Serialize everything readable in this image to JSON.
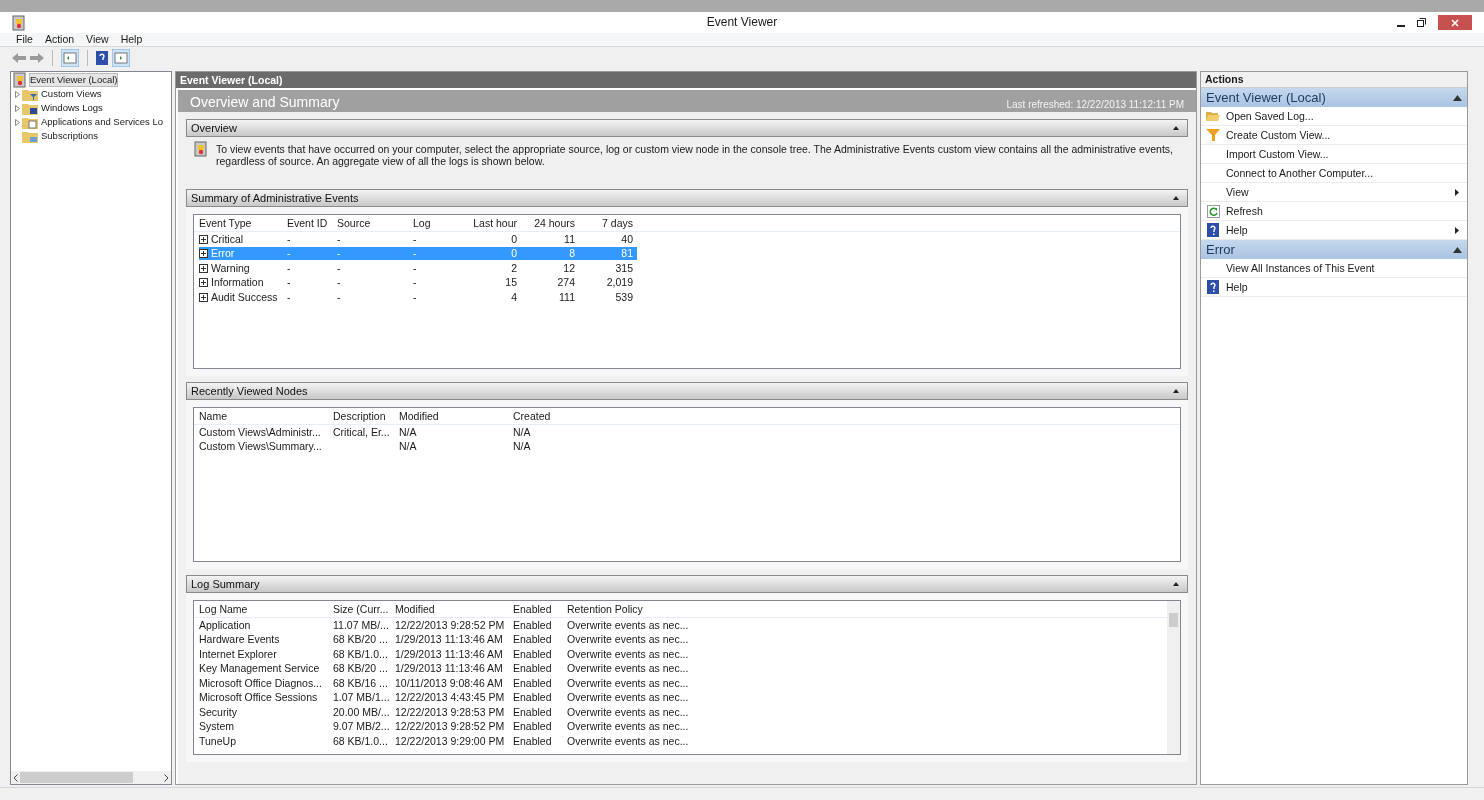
{
  "window": {
    "title": "Event Viewer"
  },
  "menu": [
    "File",
    "Action",
    "View",
    "Help"
  ],
  "tree": [
    {
      "label": "Event Viewer (Local)",
      "selected": true,
      "expandable": false
    },
    {
      "label": "Custom Views",
      "selected": false,
      "expandable": true
    },
    {
      "label": "Windows Logs",
      "selected": false,
      "expandable": true
    },
    {
      "label": "Applications and Services Lo",
      "selected": false,
      "expandable": true
    },
    {
      "label": "Subscriptions",
      "selected": false,
      "expandable": false
    }
  ],
  "center": {
    "header": "Event Viewer (Local)",
    "title": "Overview and Summary",
    "last_refreshed": "Last refreshed: 12/22/2013 11:12:11 PM",
    "overview": {
      "title": "Overview",
      "text": "To view events that have occurred on your computer, select the appropriate source, log or custom view node in the console tree. The Administrative Events custom view contains all the administrative events, regardless of source. An aggregate view of all the logs is shown below."
    },
    "summary": {
      "title": "Summary of Administrative Events",
      "columns": [
        "Event Type",
        "Event ID",
        "Source",
        "Log",
        "Last hour",
        "24 hours",
        "7 days"
      ],
      "rows": [
        {
          "cells": [
            "Critical",
            "-",
            "-",
            "-",
            "0",
            "11",
            "40"
          ],
          "selected": false
        },
        {
          "cells": [
            "Error",
            "-",
            "-",
            "-",
            "0",
            "8",
            "81"
          ],
          "selected": true
        },
        {
          "cells": [
            "Warning",
            "-",
            "-",
            "-",
            "2",
            "12",
            "315"
          ],
          "selected": false
        },
        {
          "cells": [
            "Information",
            "-",
            "-",
            "-",
            "15",
            "274",
            "2,019"
          ],
          "selected": false
        },
        {
          "cells": [
            "Audit Success",
            "-",
            "-",
            "-",
            "4",
            "111",
            "539"
          ],
          "selected": false
        }
      ]
    },
    "recent": {
      "title": "Recently Viewed Nodes",
      "columns": [
        "Name",
        "Description",
        "Modified",
        "Created"
      ],
      "rows": [
        [
          "Custom Views\\Administr...",
          "Critical, Er...",
          "N/A",
          "N/A"
        ],
        [
          "Custom Views\\Summary...",
          "",
          "N/A",
          "N/A"
        ]
      ]
    },
    "logs": {
      "title": "Log Summary",
      "columns": [
        "Log Name",
        "Size (Curr...",
        "Modified",
        "Enabled",
        "Retention Policy"
      ],
      "rows": [
        [
          "Application",
          "11.07 MB/...",
          "12/22/2013 9:28:52 PM",
          "Enabled",
          "Overwrite events as nec..."
        ],
        [
          "Hardware Events",
          "68 KB/20 ...",
          "1/29/2013 11:13:46 AM",
          "Enabled",
          "Overwrite events as nec..."
        ],
        [
          "Internet Explorer",
          "68 KB/1.0...",
          "1/29/2013 11:13:46 AM",
          "Enabled",
          "Overwrite events as nec..."
        ],
        [
          "Key Management Service",
          "68 KB/20 ...",
          "1/29/2013 11:13:46 AM",
          "Enabled",
          "Overwrite events as nec..."
        ],
        [
          "Microsoft Office Diagnos...",
          "68 KB/16 ...",
          "10/11/2013 9:08:46 AM",
          "Enabled",
          "Overwrite events as nec..."
        ],
        [
          "Microsoft Office Sessions",
          "1.07 MB/1...",
          "12/22/2013 4:43:45 PM",
          "Enabled",
          "Overwrite events as nec..."
        ],
        [
          "Security",
          "20.00 MB/...",
          "12/22/2013 9:28:53 PM",
          "Enabled",
          "Overwrite events as nec..."
        ],
        [
          "System",
          "9.07 MB/2...",
          "12/22/2013 9:28:52 PM",
          "Enabled",
          "Overwrite events as nec..."
        ],
        [
          "TuneUp",
          "68 KB/1.0...",
          "12/22/2013 9:29:00 PM",
          "Enabled",
          "Overwrite events as nec..."
        ]
      ]
    }
  },
  "actions": {
    "title": "Actions",
    "groups": [
      {
        "title": "Event Viewer (Local)",
        "expanded": true,
        "items": [
          {
            "label": "Open Saved Log...",
            "kind": "open",
            "submenu": false
          },
          {
            "label": "Create Custom View...",
            "kind": "filter",
            "submenu": false
          },
          {
            "label": "Import Custom View...",
            "kind": "plain",
            "submenu": false
          },
          {
            "label": "Connect to Another Computer...",
            "kind": "plain",
            "submenu": false
          },
          {
            "label": "View",
            "kind": "plain",
            "submenu": true
          },
          {
            "label": "Refresh",
            "kind": "refresh",
            "submenu": false
          },
          {
            "label": "Help",
            "kind": "help",
            "submenu": true
          }
        ]
      },
      {
        "title": "Error",
        "expanded": true,
        "items": [
          {
            "label": "View All Instances of This Event",
            "kind": "plain",
            "submenu": false
          },
          {
            "label": "Help",
            "kind": "help",
            "submenu": false
          }
        ]
      }
    ]
  }
}
